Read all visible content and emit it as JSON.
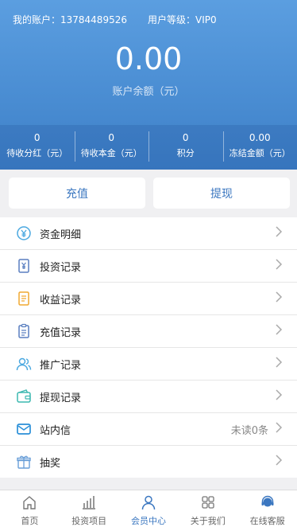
{
  "header": {
    "account": "我的账户：13784489526",
    "level": "用户等级：VIP0",
    "balance": "0.00",
    "balance_label": "账户余额（元）",
    "stats": [
      {
        "value": "0",
        "label": "待收分红（元）"
      },
      {
        "value": "0",
        "label": "待收本金（元）"
      },
      {
        "value": "0",
        "label": "积分"
      },
      {
        "value": "0.00",
        "label": "冻结金额（元）"
      }
    ]
  },
  "actions": {
    "recharge": "充值",
    "withdraw": "提现"
  },
  "menu": [
    {
      "label": "资金明细",
      "icon": "yen-circle-icon"
    },
    {
      "label": "投资记录",
      "icon": "yen-document-icon"
    },
    {
      "label": "收益记录",
      "icon": "note-icon"
    },
    {
      "label": "充值记录",
      "icon": "clipboard-icon"
    },
    {
      "label": "推广记录",
      "icon": "users-icon"
    },
    {
      "label": "提现记录",
      "icon": "wallet-icon"
    },
    {
      "label": "站内信",
      "icon": "mail-icon",
      "extra": "未读0条"
    },
    {
      "label": "抽奖",
      "icon": "gift-icon"
    }
  ],
  "tabbar": [
    {
      "label": "首页",
      "icon": "home-icon"
    },
    {
      "label": "投资项目",
      "icon": "bar-chart-icon"
    },
    {
      "label": "会员中心",
      "icon": "user-icon",
      "active": true
    },
    {
      "label": "关于我们",
      "icon": "grid-icon"
    },
    {
      "label": "在线客服",
      "icon": "headset-icon"
    }
  ],
  "colors": {
    "header_top": "#5b9ee0",
    "header_bottom": "#3d80c8",
    "accent": "#3b77c0"
  }
}
